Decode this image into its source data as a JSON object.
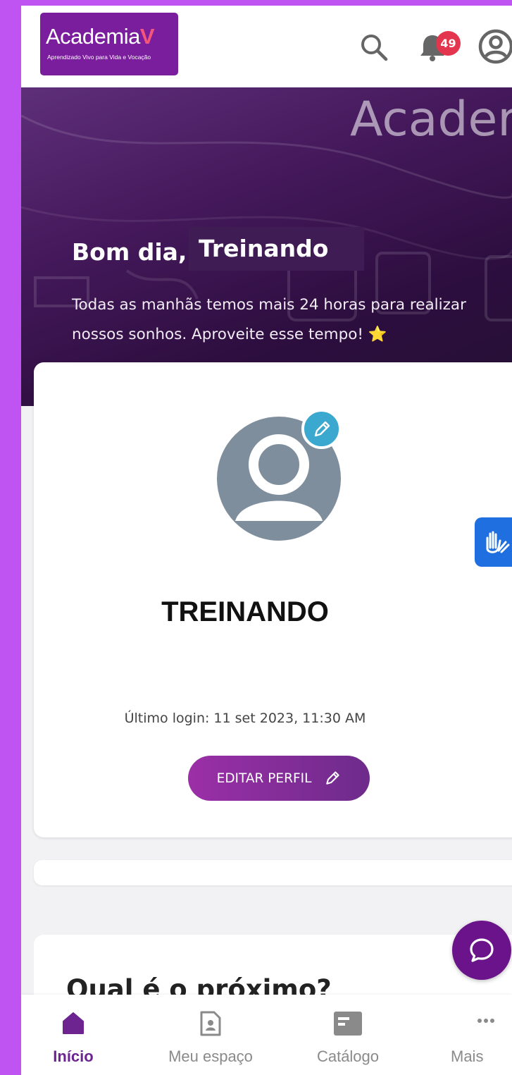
{
  "header": {
    "logo_text": "Academia",
    "logo_accent": "V",
    "logo_tagline": "Aprendizado Vivo para Vida e Vocação",
    "notification_count": "49",
    "icons": [
      "search-icon",
      "bell-icon",
      "account-icon"
    ]
  },
  "hero": {
    "watermark": "Acader",
    "greeting_prefix": "Bom dia,",
    "greeting_name": "Treinando",
    "message": "Todas as manhãs temos mais 24 horas para realizar nossos sonhos. Aproveite esse tempo! ⭐"
  },
  "profile": {
    "name": "TREINANDO",
    "last_login": "Último login: 11 set 2023, 11:30 AM",
    "edit_button": "EDITAR PERFIL"
  },
  "next_section": {
    "title": "Qual é o próximo?"
  },
  "bottom_nav": {
    "items": [
      {
        "label": "Início",
        "icon": "home-icon",
        "active": true
      },
      {
        "label": "Meu espaço",
        "icon": "profile-document-icon",
        "active": false
      },
      {
        "label": "Catálogo",
        "icon": "catalog-icon",
        "active": false
      },
      {
        "label": "Mais",
        "icon": "more-icon",
        "active": false
      }
    ]
  },
  "colors": {
    "frame": "#c054f2",
    "brand_purple": "#6d2491",
    "badge_red": "#e3354d",
    "accessibility_blue": "#1f6fe0",
    "edit_avatar_teal": "#3ba8cf"
  }
}
